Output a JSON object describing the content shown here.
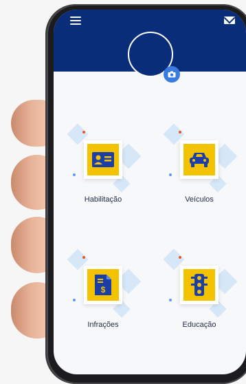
{
  "colors": {
    "header": "#0a2d7a",
    "accent_yellow": "#f3c300",
    "icon_blue": "#1b3fa6",
    "camera_blue": "#3a7be0"
  },
  "header": {
    "menu_icon": "hamburger-menu-icon",
    "mail_icon": "envelope-icon",
    "camera_icon": "camera-icon"
  },
  "tiles": [
    {
      "label": "Habilitação",
      "icon": "id-card-icon"
    },
    {
      "label": "Veículos",
      "icon": "car-icon"
    },
    {
      "label": "Infrações",
      "icon": "document-dollar-icon"
    },
    {
      "label": "Educação",
      "icon": "traffic-light-icon"
    }
  ]
}
